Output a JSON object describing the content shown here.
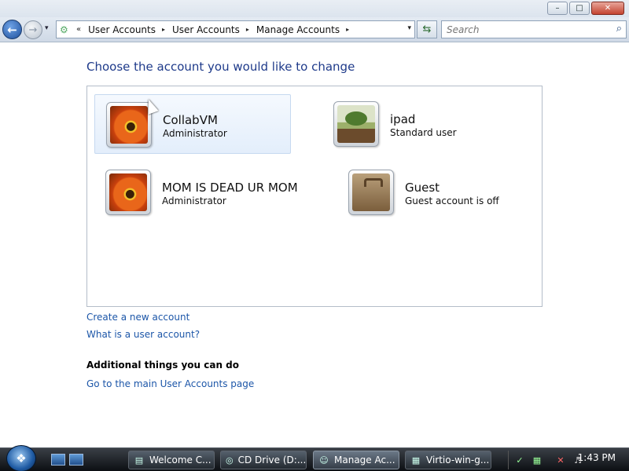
{
  "window": {
    "minimize_glyph": "–",
    "maximize_glyph": "□",
    "close_glyph": "✕"
  },
  "nav": {
    "back_glyph": "←",
    "forward_glyph": "→",
    "history_glyph": "▾",
    "overflow": "«",
    "breadcrumbs": [
      "User Accounts",
      "User Accounts",
      "Manage Accounts"
    ],
    "separator": "▸",
    "dropdown_glyph": "▾",
    "refresh_glyph": "⇆",
    "search_placeholder": "Search",
    "search_glyph": "⌕"
  },
  "main": {
    "heading": "Choose the account you would like to change",
    "accounts": [
      {
        "name": "CollabVM",
        "type": "Administrator",
        "picture": "flower-picture",
        "selected": true
      },
      {
        "name": "ipad",
        "type": "Standard user",
        "picture": "bonsai-picture",
        "selected": false
      },
      {
        "name": "MOM IS DEAD UR MOM",
        "type": "Administrator",
        "picture": "flower-picture",
        "selected": false
      },
      {
        "name": "Guest",
        "type": "Guest account is off",
        "picture": "suitcase-picture",
        "selected": false
      }
    ],
    "links": {
      "create_account": "Create a new account",
      "what_is": "What is a user account?"
    },
    "additional": {
      "title": "Additional things you can do",
      "main_page_link": "Go to the main User Accounts page"
    }
  },
  "taskbar": {
    "start_glyph": "❖",
    "buttons": [
      {
        "label": "Welcome C...",
        "icon": "document-icon",
        "glyph": "▤",
        "active": false
      },
      {
        "label": "CD Drive (D:...",
        "icon": "cd-drive-icon",
        "glyph": "◎",
        "active": false
      },
      {
        "label": "Manage Ac...",
        "icon": "users-icon",
        "glyph": "☺",
        "active": true
      },
      {
        "label": "Virtio-win-g...",
        "icon": "folder-icon",
        "glyph": "▦",
        "active": false
      }
    ],
    "clock": "1:43 PM"
  },
  "colors": {
    "link": "#1c56a8",
    "heading": "#1e3a8a",
    "selection": "#e3eefb"
  }
}
